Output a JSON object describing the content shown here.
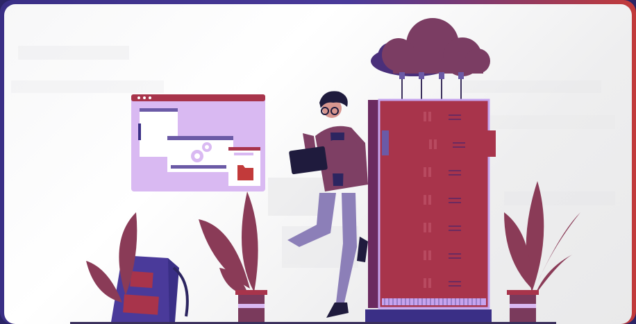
{
  "illustration": {
    "alt": "",
    "colors": {
      "frame_left": "#3a2f86",
      "frame_right": "#c23a3a",
      "server": "#a8344b",
      "server_edge": "#6b2a60",
      "cloud": "#7b3d63",
      "cloud_shadow": "#4a2f7a",
      "window": "#d9b9f2",
      "plant": "#8a3b57",
      "pot": "#7a3a5c",
      "person_pants": "#8c7fb8",
      "person_jacket": "#7e3f64",
      "person_hair": "#1f1b3d"
    }
  }
}
